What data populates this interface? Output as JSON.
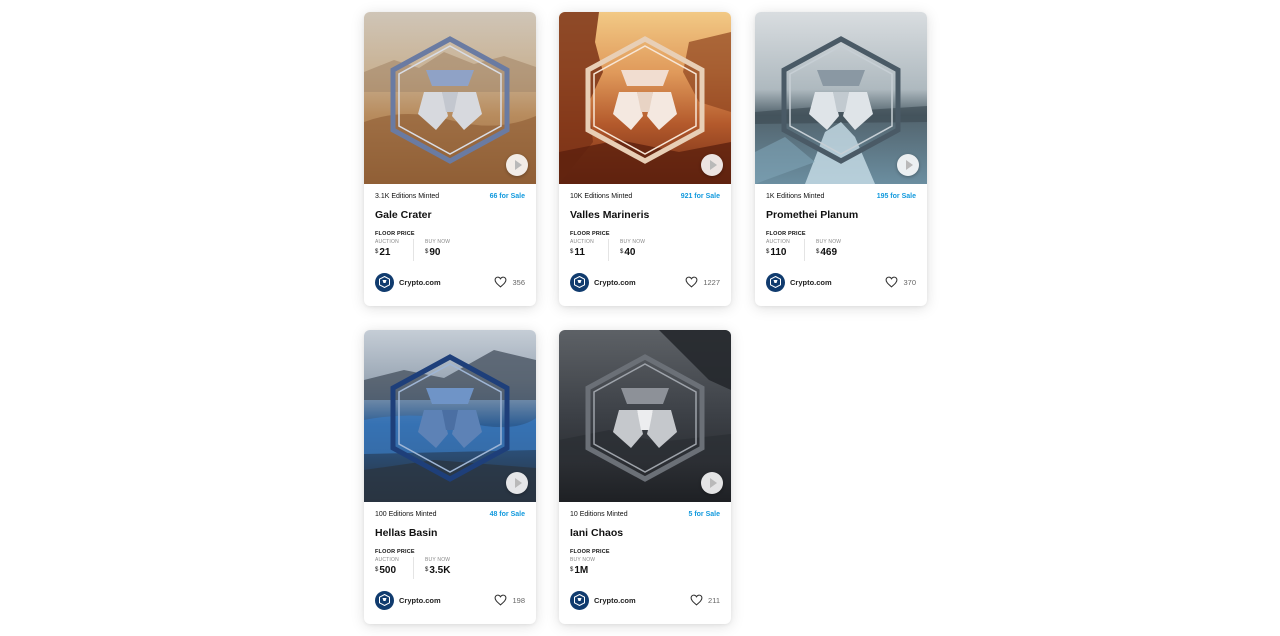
{
  "labels": {
    "floor_price": "FLOOR PRICE",
    "auction": "AUCTION",
    "buy_now": "BUY NOW",
    "currency": "$"
  },
  "cards": [
    {
      "title": "Gale Crater",
      "editions": "3.1K Editions Minted",
      "for_sale": "66 for Sale",
      "auction": "21",
      "buy_now": "90",
      "creator": "Crypto.com",
      "likes": "356",
      "theme": "desert"
    },
    {
      "title": "Valles Marineris",
      "editions": "10K Editions Minted",
      "for_sale": "921 for Sale",
      "auction": "11",
      "buy_now": "40",
      "creator": "Crypto.com",
      "likes": "1227",
      "theme": "canyon"
    },
    {
      "title": "Promethei Planum",
      "editions": "1K Editions Minted",
      "for_sale": "195 for Sale",
      "auction": "110",
      "buy_now": "469",
      "creator": "Crypto.com",
      "likes": "370",
      "theme": "ice"
    },
    {
      "title": "Hellas Basin",
      "editions": "100 Editions Minted",
      "for_sale": "48 for Sale",
      "auction": "500",
      "buy_now": "3.5K",
      "creator": "Crypto.com",
      "likes": "198",
      "theme": "blue"
    },
    {
      "title": "Iani Chaos",
      "editions": "10 Editions Minted",
      "for_sale": "5 for Sale",
      "buy_now": "1M",
      "creator": "Crypto.com",
      "likes": "211",
      "theme": "dark"
    }
  ],
  "colors": {
    "sale_accent": "#1199dd",
    "avatar_bg": "#103b6e"
  }
}
